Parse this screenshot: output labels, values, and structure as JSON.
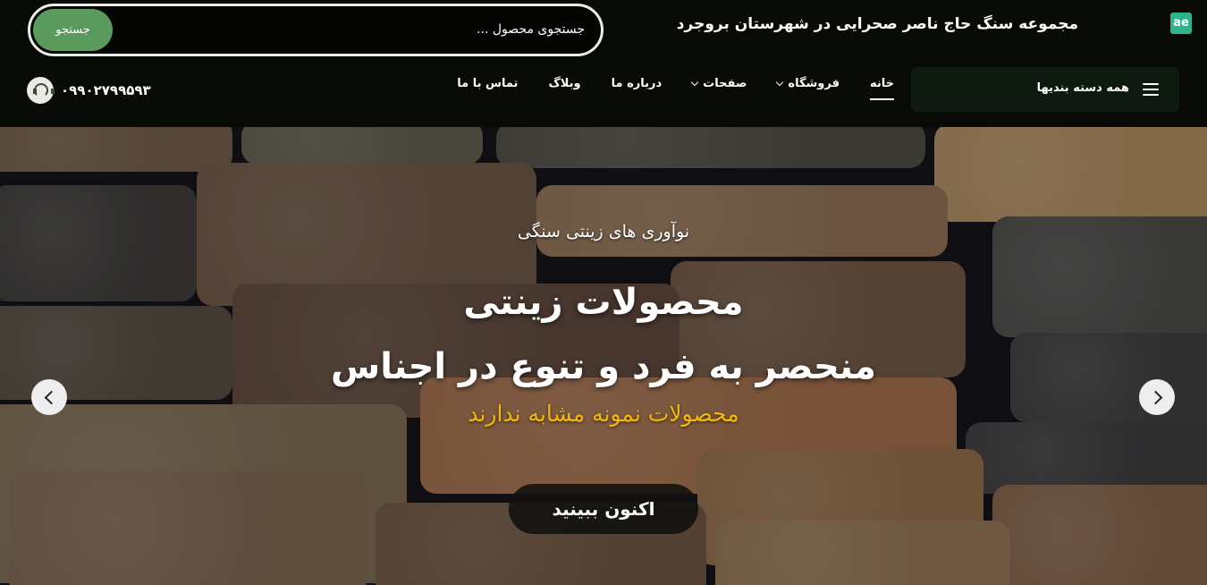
{
  "header": {
    "logo_text": "ae",
    "site_title": "مجموعه سنگ حاج ناصر صحرایی در شهرستان بروجرد",
    "search": {
      "placeholder": "جستجوی محصول ...",
      "button_label": "جستجو"
    },
    "categories_label": "همه دسته بندیها",
    "nav": [
      {
        "label": "خانه",
        "active": true,
        "dropdown": false
      },
      {
        "label": "فروشگاه",
        "active": false,
        "dropdown": true
      },
      {
        "label": "صفحات",
        "active": false,
        "dropdown": true
      },
      {
        "label": "درباره ما",
        "active": false,
        "dropdown": false
      },
      {
        "label": "وبلاگ",
        "active": false,
        "dropdown": false
      },
      {
        "label": "تماس با ما",
        "active": false,
        "dropdown": false
      }
    ],
    "phone": "۰۹۹۰۲۷۹۹۵۹۳",
    "colors": {
      "background": "#070a05",
      "search_button": "#5a9a5c",
      "logo": "#2fb38a"
    }
  },
  "hero": {
    "kicker": "نوآوری های زینتی سنگی",
    "title_line1": "محصولات زینتی",
    "title_line2": "منحصر به فرد و تنوع در اجناس",
    "subtitle": "محصولات نمونه مشابه ندارند",
    "cta_label": "اکنون ببینید",
    "prev_icon": "chevron-left-icon",
    "next_icon": "chevron-right-icon",
    "colors": {
      "subtitle": "#f2b90a"
    }
  }
}
